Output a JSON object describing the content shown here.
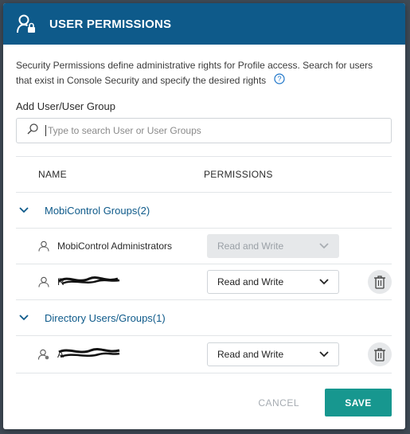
{
  "dialog": {
    "title": "USER PERMISSIONS",
    "description": "Security Permissions define administrative rights for Profile access. Search for users that exist in Console Security and specify the desired rights",
    "add_label": "Add User/User Group",
    "search_placeholder": "Type to search User or User Groups"
  },
  "table": {
    "col_name": "NAME",
    "col_permissions": "PERMISSIONS",
    "groups": [
      {
        "label": "MobiControl Groups(2)",
        "rows": [
          {
            "name": "MobiControl Administrators",
            "permission": "Read and Write",
            "disabled": true
          },
          {
            "name": "R",
            "permission": "Read and Write",
            "disabled": false
          }
        ]
      },
      {
        "label": "Directory Users/Groups(1)",
        "rows": [
          {
            "name": "A",
            "permission": "Read and Write",
            "disabled": false
          }
        ]
      }
    ]
  },
  "footer": {
    "cancel": "CANCEL",
    "save": "SAVE"
  },
  "colors": {
    "header": "#0e5a8a",
    "accent": "#17978f",
    "group_text": "#0e5a8a"
  }
}
